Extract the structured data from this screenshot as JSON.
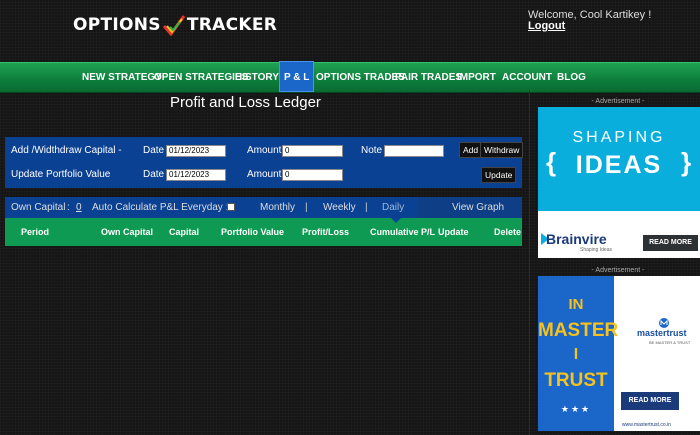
{
  "header": {
    "logo_left": "OPTIONS",
    "logo_right": "TRACKER",
    "welcome": "Welcome, Cool Kartikey !",
    "logout": "Logout"
  },
  "nav": {
    "items": [
      "NEW STRATEGY",
      "OPEN STRATEGIES",
      "HISTORY",
      "P & L",
      "OPTIONS TRADES",
      "PAIR TRADES",
      "IMPORT",
      "ACCOUNT",
      "BLOG"
    ],
    "active": "P & L"
  },
  "page": {
    "title": "Profit and Loss Ledger"
  },
  "capital_form": {
    "label": "Add /Widthdraw Capital -",
    "date_label": "Date",
    "date_value": "01/12/2023",
    "amount_label": "Amount",
    "amount_value": "0",
    "note_label": "Note",
    "note_value": "",
    "add_button": "Add",
    "withdraw_button": "Withdraw"
  },
  "portfolio_form": {
    "label": "Update Portfolio Value",
    "date_label": "Date",
    "date_value": "01/12/2023",
    "amount_label": "Amount",
    "amount_value": "0",
    "update_button": "Update"
  },
  "ledger": {
    "own_capital_label": "Own Capital",
    "own_capital_sep": ":",
    "own_capital_value": "0",
    "auto_calc_label": "Auto Calculate P&L Everyday :",
    "auto_calc_checked": false,
    "periods": [
      "Monthly",
      "Weekly",
      "Daily"
    ],
    "period_sep": "|",
    "selected_period": "Daily",
    "view_graph": "View Graph",
    "columns": [
      "Period",
      "Own Capital",
      "Capital",
      "Portfolio Value",
      "Profit/Loss",
      "Cumulative P/L",
      "Update",
      "Delete"
    ],
    "rows": []
  },
  "ads": {
    "label": "- Advertisement -",
    "ad1": {
      "line1": "SHAPING",
      "line2": "IDEAS",
      "brand": "Brainvire",
      "tagline": "Shaping Ideas",
      "button": "READ MORE"
    },
    "ad2": {
      "words": [
        "IN",
        "MASTER",
        "I",
        "TRUST"
      ],
      "stars": "★★★",
      "brand": "mastertrust",
      "sub": "BE MASTER & TRUST",
      "button": "READ MORE",
      "url": "www.mastertrust.co.in"
    }
  },
  "colors": {
    "nav_green": "#0e8a45",
    "active_blue": "#1a66c9",
    "panel_blue": "#0b4193",
    "table_green": "#0e9a52"
  }
}
